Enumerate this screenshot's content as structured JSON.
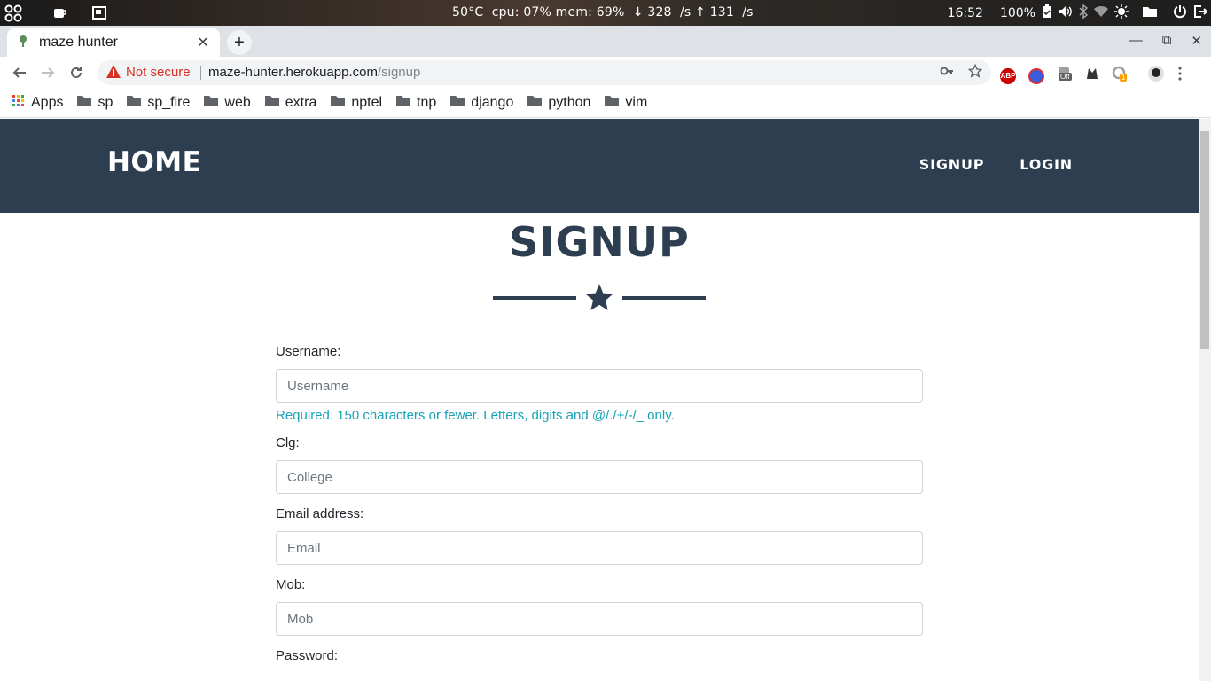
{
  "os_panel": {
    "system_stats": "50°C  cpu: 07% mem: 69%  ↓ 328  /s ↑ 131  /s",
    "clock": "16:52",
    "battery": "100%"
  },
  "browser": {
    "tab": {
      "title": "maze hunter",
      "close": "✕"
    },
    "new_tab": "+",
    "window_controls": {
      "minimize": "—",
      "restore": "⧉",
      "close": "✕"
    },
    "security_label": "Not secure",
    "url_host": "maze-hunter.herokuapp.com",
    "url_path": "/signup",
    "bookmarks": [
      {
        "label": "Apps",
        "icon": "apps-grid-icon"
      },
      {
        "label": "sp",
        "icon": "folder-icon"
      },
      {
        "label": "sp_fire",
        "icon": "folder-icon"
      },
      {
        "label": "web",
        "icon": "folder-icon"
      },
      {
        "label": "extra",
        "icon": "folder-icon"
      },
      {
        "label": "nptel",
        "icon": "folder-icon"
      },
      {
        "label": "tnp",
        "icon": "folder-icon"
      },
      {
        "label": "django",
        "icon": "folder-icon"
      },
      {
        "label": "python",
        "icon": "folder-icon"
      },
      {
        "label": "vim",
        "icon": "folder-icon"
      }
    ],
    "extensions": {
      "abp": "ABP",
      "off_badge": "Off",
      "counter_badge": "1"
    }
  },
  "site": {
    "brand": "HOME",
    "nav": {
      "signup": "SIGNUP",
      "login": "LOGIN"
    },
    "colors": {
      "navbar": "#2c3e50",
      "help_text": "#17a2b8"
    },
    "page_title": "SIGNUP",
    "form": {
      "username": {
        "label": "Username:",
        "placeholder": "Username",
        "value": "",
        "help": "Required. 150 characters or fewer. Letters, digits and @/./+/-/_ only."
      },
      "college": {
        "label": "Clg:",
        "placeholder": "College",
        "value": ""
      },
      "email": {
        "label": "Email address:",
        "placeholder": "Email",
        "value": ""
      },
      "mobile": {
        "label": "Mob:",
        "placeholder": "Mob",
        "value": ""
      },
      "password": {
        "label": "Password:"
      }
    }
  }
}
